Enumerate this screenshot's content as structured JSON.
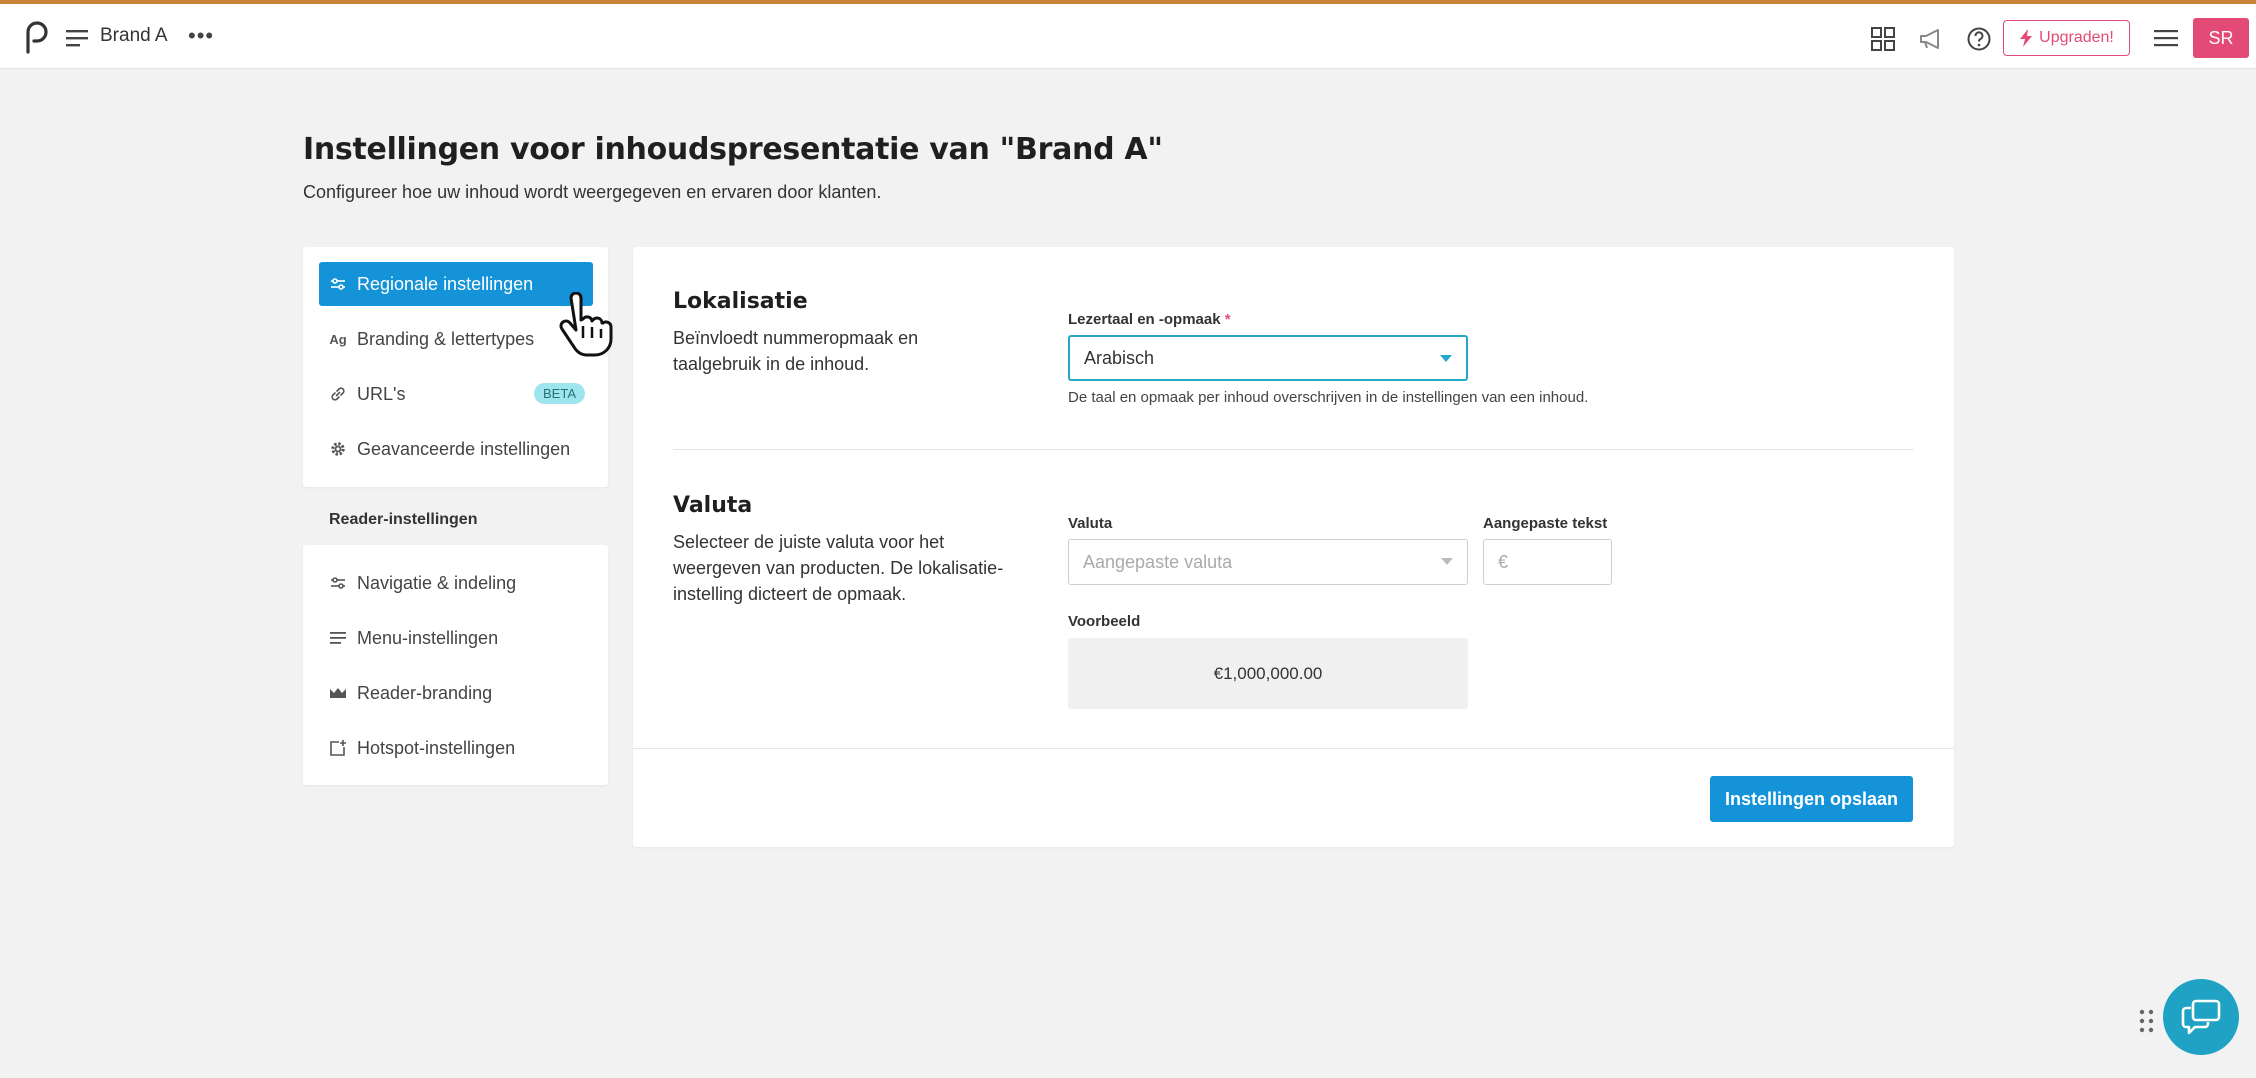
{
  "topbar": {
    "brand_name": "Brand A",
    "more_label": "•••",
    "upgrade_label": "Upgraden!",
    "avatar_initials": "SR",
    "icons": [
      "apps-grid-icon",
      "megaphone-icon",
      "help-icon",
      "menu-icon"
    ]
  },
  "page": {
    "title": "Instellingen voor inhoudspresentatie van \"Brand A\"",
    "subtitle": "Configureer hoe uw inhoud wordt weergegeven en ervaren door klanten."
  },
  "sidebar": {
    "items": [
      {
        "label": "Regionale instellingen",
        "icon": "sliders-icon",
        "active": true
      },
      {
        "label": "Branding & lettertypes",
        "icon": "font-icon"
      },
      {
        "label": "URL's",
        "icon": "link-icon",
        "badge": "BETA"
      },
      {
        "label": "Geavanceerde instellingen",
        "icon": "gear-icon"
      }
    ],
    "group_label": "Reader-instellingen",
    "reader_items": [
      {
        "label": "Navigatie & indeling",
        "icon": "sliders-icon"
      },
      {
        "label": "Menu-instellingen",
        "icon": "menu-icon"
      },
      {
        "label": "Reader-branding",
        "icon": "crown-icon"
      },
      {
        "label": "Hotspot-instellingen",
        "icon": "hotspot-icon"
      }
    ]
  },
  "localisation": {
    "title": "Lokalisatie",
    "description": "Beïnvloedt nummeropmaak en taalgebruik in de inhoud.",
    "field_label": "Lezertaal en -opmaak",
    "required_mark": "*",
    "selected_value": "Arabisch",
    "help_text": "De taal en opmaak per inhoud overschrijven in de instellingen van een inhoud."
  },
  "currency": {
    "title": "Valuta",
    "description": "Selecteer de juiste valuta voor het weergeven van producten. De lokalisatie-instelling dicteert de opmaak.",
    "currency_label": "Valuta",
    "currency_placeholder": "Aangepaste valuta",
    "custom_text_label": "Aangepaste tekst",
    "custom_text_placeholder": "€",
    "preview_label": "Voorbeeld",
    "preview_value": "€1,000,000.00"
  },
  "actions": {
    "save_label": "Instellingen opslaan"
  },
  "colors": {
    "accent": "#1593d8",
    "upgrade": "#e34a75",
    "focus": "#25a8c7",
    "chat": "#1fa2c4",
    "topbar_stripe": "#c8823a"
  }
}
